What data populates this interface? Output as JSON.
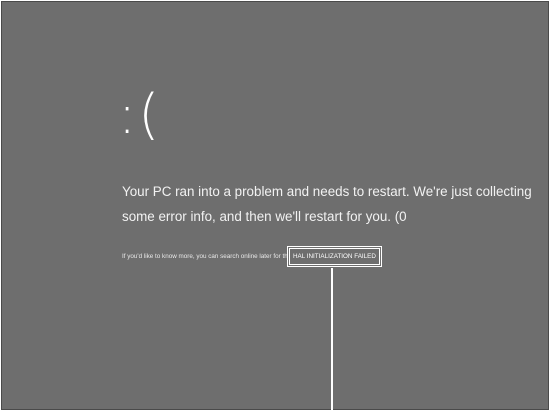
{
  "bsod": {
    "face": ":(",
    "message": "Your PC ran into a problem and needs to restart. We're just collecting some error info, and then we'll restart for you. (0",
    "detail_prefix": "If you'd like to know more, you can search online later for this error:",
    "stop_code": "HAL INITIALIZATION FAILED"
  },
  "colors": {
    "background": "#6e6e6e",
    "text": "#ffffff"
  }
}
